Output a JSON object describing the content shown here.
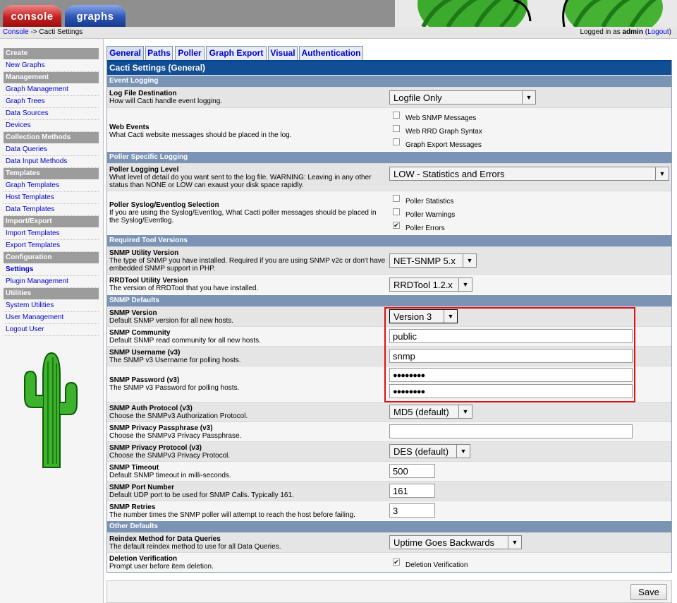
{
  "header": {
    "tabs": [
      "console",
      "graphs"
    ]
  },
  "subbar": {
    "crumb_link": "Console",
    "crumb_rest": " -> Cacti Settings",
    "login_prefix": "Logged in as ",
    "user": "admin",
    "logout": "Logout"
  },
  "sidebar": [
    {
      "type": "head",
      "label": "Create"
    },
    {
      "type": "item",
      "label": "New Graphs"
    },
    {
      "type": "head",
      "label": "Management"
    },
    {
      "type": "item",
      "label": "Graph Management"
    },
    {
      "type": "item",
      "label": "Graph Trees"
    },
    {
      "type": "item",
      "label": "Data Sources"
    },
    {
      "type": "item",
      "label": "Devices"
    },
    {
      "type": "head",
      "label": "Collection Methods"
    },
    {
      "type": "item",
      "label": "Data Queries"
    },
    {
      "type": "item",
      "label": "Data Input Methods"
    },
    {
      "type": "head",
      "label": "Templates"
    },
    {
      "type": "item",
      "label": "Graph Templates"
    },
    {
      "type": "item",
      "label": "Host Templates"
    },
    {
      "type": "item",
      "label": "Data Templates"
    },
    {
      "type": "head",
      "label": "Import/Export"
    },
    {
      "type": "item",
      "label": "Import Templates"
    },
    {
      "type": "item",
      "label": "Export Templates"
    },
    {
      "type": "head",
      "label": "Configuration"
    },
    {
      "type": "item",
      "label": "Settings",
      "selected": true
    },
    {
      "type": "item",
      "label": "Plugin Management"
    },
    {
      "type": "head",
      "label": "Utilities"
    },
    {
      "type": "item",
      "label": "System Utilities"
    },
    {
      "type": "item",
      "label": "User Management"
    },
    {
      "type": "item",
      "label": "Logout User"
    }
  ],
  "settings_tabs": [
    "General",
    "Paths",
    "Poller",
    "Graph Export",
    "Visual",
    "Authentication"
  ],
  "panel_title": "Cacti Settings (General)",
  "sections": {
    "event_logging": "Event Logging",
    "poller_logging": "Poller Specific Logging",
    "tool_versions": "Required Tool Versions",
    "snmp_defaults": "SNMP Defaults",
    "other_defaults": "Other Defaults"
  },
  "rows": {
    "log_dest": {
      "title": "Log File Destination",
      "desc": "How will Cacti handle event logging.",
      "value": "Logfile Only"
    },
    "web_events": {
      "title": "Web Events",
      "desc": "What Cacti website messages should be placed in the log.",
      "options": [
        "Web SNMP Messages",
        "Web RRD Graph Syntax",
        "Graph Export Messages"
      ]
    },
    "poller_level": {
      "title": "Poller Logging Level",
      "desc": "What level of detail do you want sent to the log file. WARNING: Leaving in any other status than NONE or LOW can exaust your disk space rapidly.",
      "value": "LOW - Statistics and Errors"
    },
    "syslog_sel": {
      "title": "Poller Syslog/Eventlog Selection",
      "desc": "If you are using the Syslog/Eventlog, What Cacti poller messages should be placed in the Syslog/Eventlog.",
      "options": [
        "Poller Statistics",
        "Poller Warnings",
        "Poller Errors"
      ]
    },
    "snmp_util": {
      "title": "SNMP Utility Version",
      "desc": "The type of SNMP you have installed. Required if you are using SNMP v2c or don't have embedded SNMP support in PHP.",
      "value": "NET-SNMP 5.x"
    },
    "rrdtool": {
      "title": "RRDTool Utility Version",
      "desc": "The version of RRDTool that you have installed.",
      "value": "RRDTool 1.2.x"
    },
    "snmp_version": {
      "title": "SNMP Version",
      "desc": "Default SNMP version for all new hosts.",
      "value": "Version 3"
    },
    "snmp_community": {
      "title": "SNMP Community",
      "desc": "Default SNMP read community for all new hosts.",
      "value": "public"
    },
    "snmp_user": {
      "title": "SNMP Username (v3)",
      "desc": "The SNMP v3 Username for polling hosts.",
      "value": "snmp"
    },
    "snmp_pass": {
      "title": "SNMP Password (v3)",
      "desc": "The SNMP v3 Password for polling hosts.",
      "value": "●●●●●●●●",
      "confirm": "●●●●●●●●"
    },
    "auth_proto": {
      "title": "SNMP Auth Protocol (v3)",
      "desc": "Choose the SNMPv3 Authorization Protocol.",
      "value": "MD5 (default)"
    },
    "priv_pass": {
      "title": "SNMP Privacy Passphrase (v3)",
      "desc": "Choose the SNMPv3 Privacy Passphrase.",
      "value": ""
    },
    "priv_proto": {
      "title": "SNMP Privacy Protocol (v3)",
      "desc": "Choose the SNMPv3 Privacy Protocol.",
      "value": "DES (default)"
    },
    "timeout": {
      "title": "SNMP Timeout",
      "desc": "Default SNMP timeout in milli-seconds.",
      "value": "500"
    },
    "port": {
      "title": "SNMP Port Number",
      "desc": "Default UDP port to be used for SNMP Calls. Typically 161.",
      "value": "161"
    },
    "retries": {
      "title": "SNMP Retries",
      "desc": "The number times the SNMP poller will attempt to reach the host before failing.",
      "value": "3"
    },
    "reindex": {
      "title": "Reindex Method for Data Queries",
      "desc": "The default reindex method to use for all Data Queries.",
      "value": "Uptime Goes Backwards"
    },
    "del_verify": {
      "title": "Deletion Verification",
      "desc": "Prompt user before item deletion.",
      "option": "Deletion Verification"
    }
  },
  "checked": {
    "web_events": [
      false,
      false,
      false
    ],
    "syslog_sel": [
      false,
      false,
      true
    ],
    "del_verify": true
  },
  "check_mark": "✔",
  "save_label": "Save",
  "colors": {
    "highlight": "#dd1111",
    "section": "#7b93b4",
    "title": "#114e94"
  }
}
